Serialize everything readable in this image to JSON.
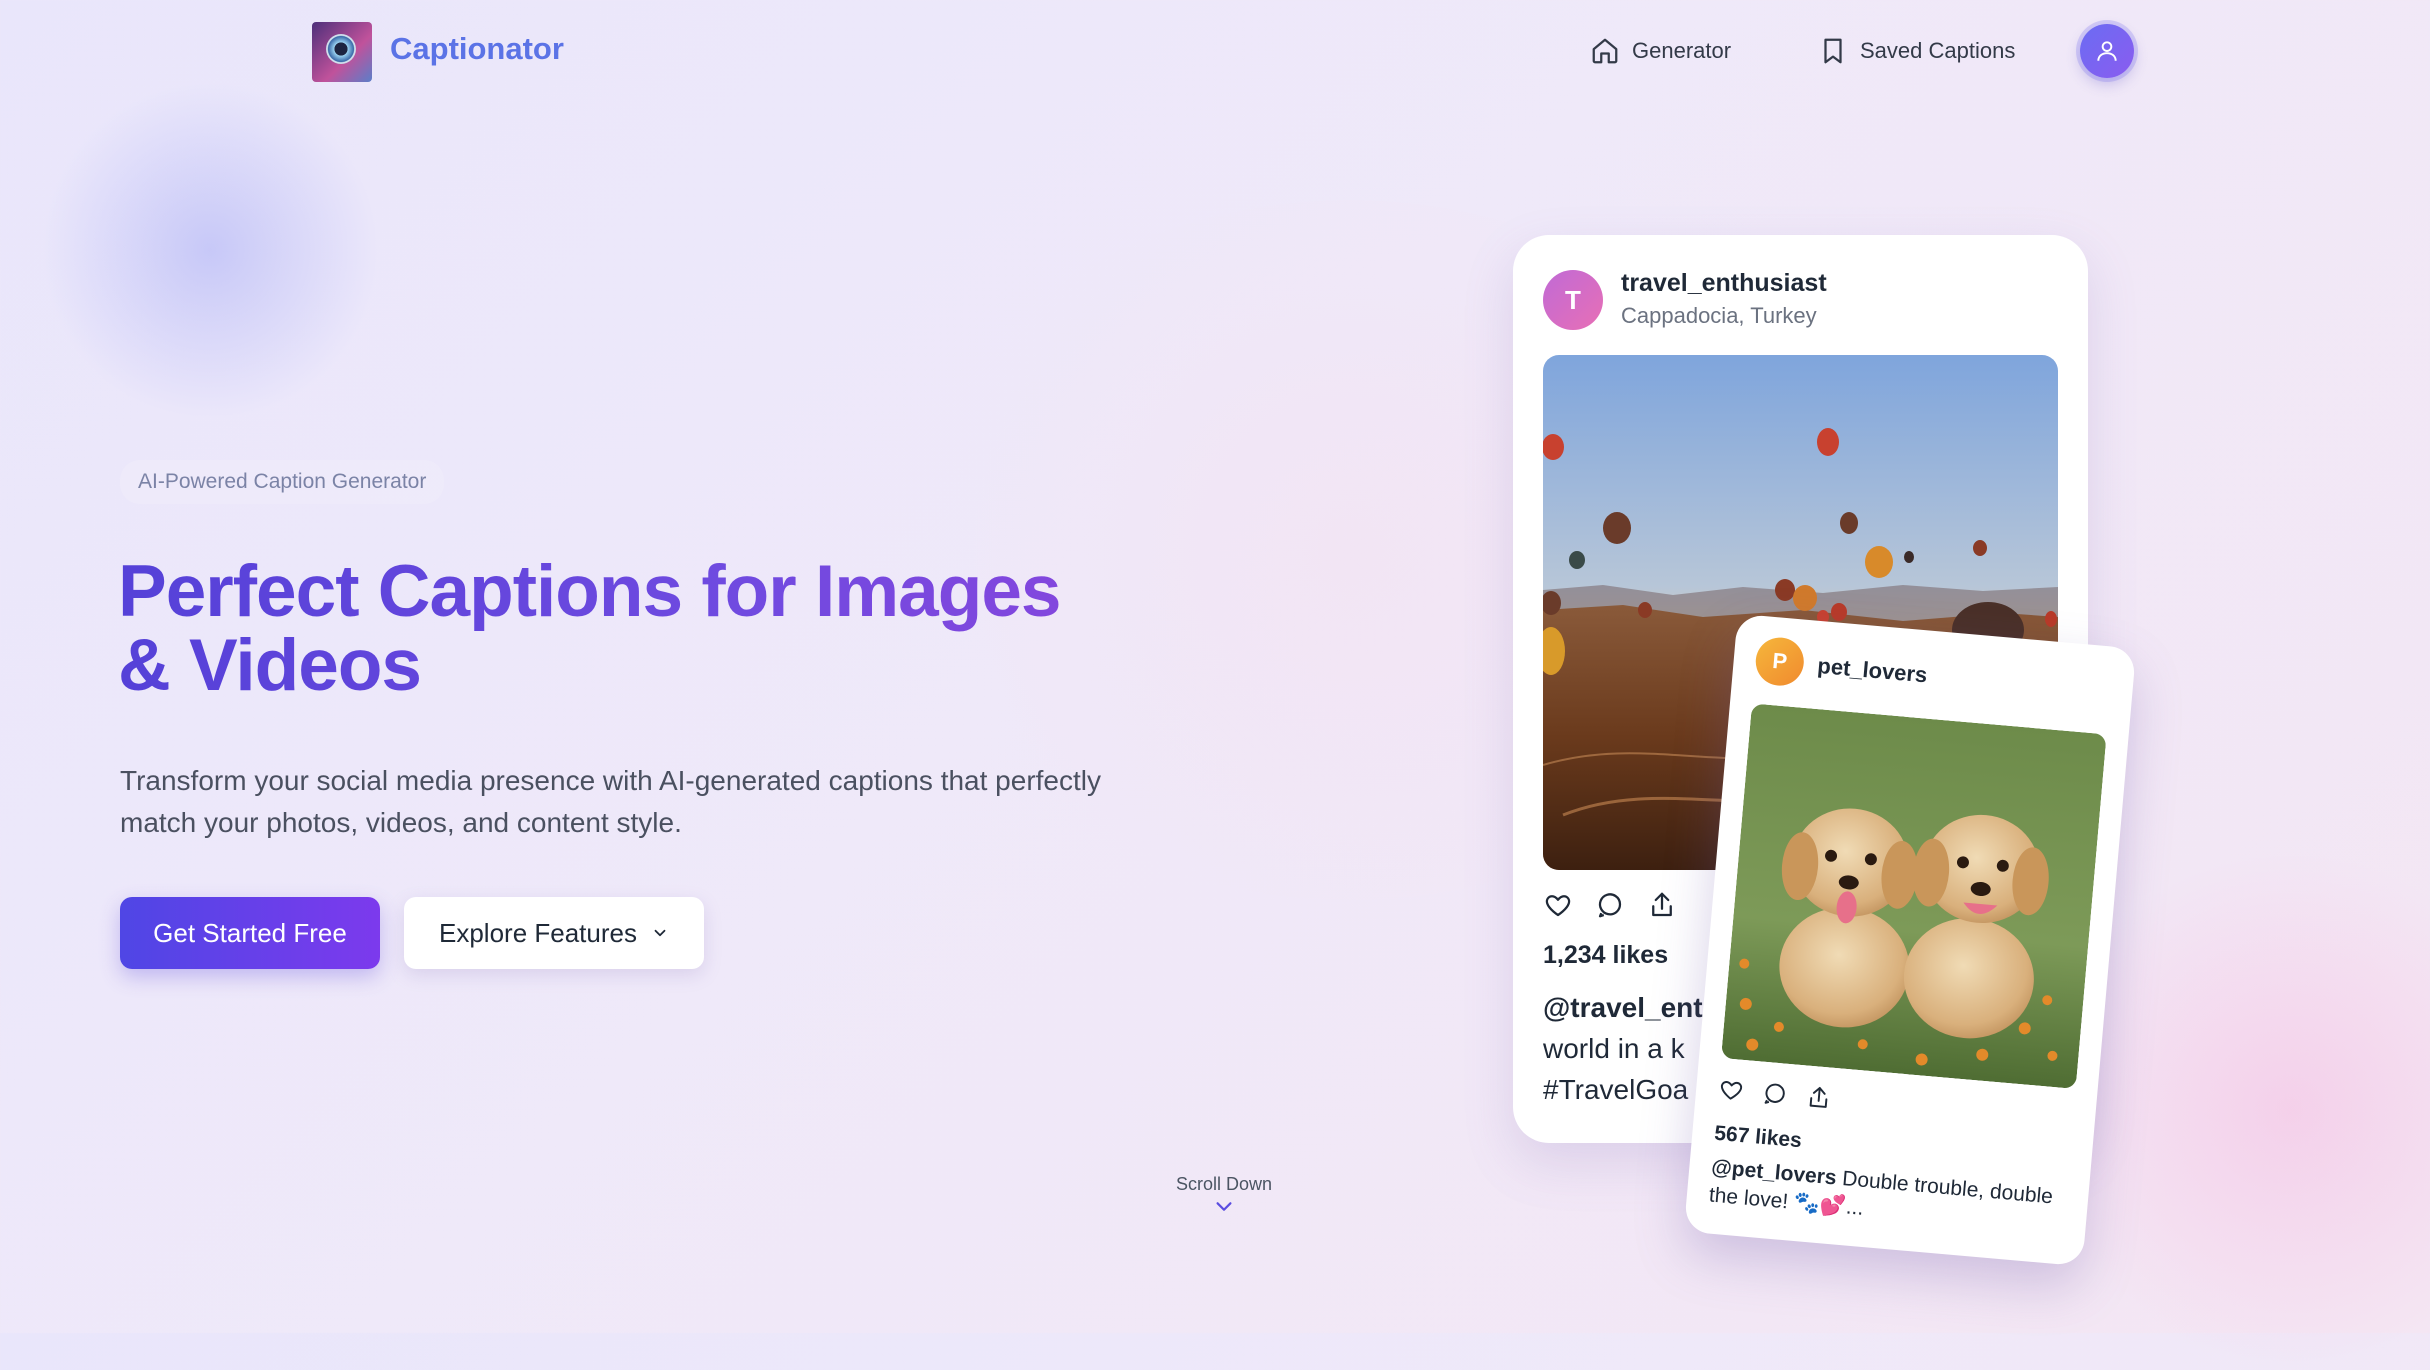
{
  "brand": {
    "name": "Captionator"
  },
  "nav": {
    "items": [
      {
        "label": "Generator",
        "icon": "home-icon"
      },
      {
        "label": "Saved Captions",
        "icon": "bookmark-icon"
      }
    ],
    "profile_icon": "user-icon"
  },
  "hero": {
    "badge": "AI-Powered Caption Generator",
    "headline_line1": "Perfect Captions for Images",
    "headline_line2": "& Videos",
    "subtitle_line1": "Transform your social media presence with AI-generated captions that perfectly",
    "subtitle_line2": "match your photos, videos, and content style.",
    "primary_button": "Get Started Free",
    "secondary_button": "Explore Features",
    "scroll_label": "Scroll Down"
  },
  "post1": {
    "avatar_letter": "T",
    "username": "travel_enthusiast",
    "location": "Cappadocia, Turkey",
    "likes": "1,234 likes",
    "caption_user": "@travel_enth",
    "caption_line2": "world in a k",
    "caption_line3": "#TravelGoa"
  },
  "post2": {
    "avatar_letter": "P",
    "username": "pet_lovers",
    "likes": "567 likes",
    "caption_user": "@pet_lovers",
    "caption_text": " Double trouble, double the love! 🐾💕..."
  },
  "colors": {
    "brand": "#5b73e6",
    "primary_gradient_start": "#4f46e5",
    "primary_gradient_end": "#7c3aed"
  }
}
